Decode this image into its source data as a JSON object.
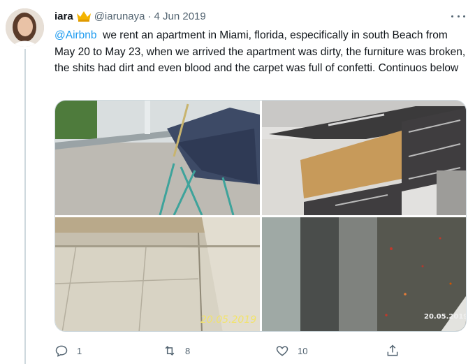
{
  "tweet": {
    "author_name": "iara",
    "author_handle": "@iarunaya",
    "separator": "·",
    "date": "4 Jun 2019",
    "mention": "@Airbnb",
    "body": "  we rent an apartment in Miami, florida, especifically in south Beach from May 20 to May 23, when we arrived the apartment was dirty, the furniture was broken, the shits had dirt and even blood and the carpet was full of confetti. Continuos below",
    "media": [
      {
        "stamp": ""
      },
      {
        "stamp": ""
      },
      {
        "stamp": "20.05.2019"
      },
      {
        "stamp": "20.05.2019"
      }
    ]
  },
  "actions": {
    "replies": "1",
    "retweets": "8",
    "likes": "10"
  },
  "icons": [
    "crown-emoji-icon",
    "more-icon",
    "reply-icon",
    "retweet-icon",
    "like-icon",
    "share-icon"
  ],
  "colors": {
    "link": "#1d9bf0",
    "muted": "#536471",
    "thread_line": "#cfd9de"
  }
}
